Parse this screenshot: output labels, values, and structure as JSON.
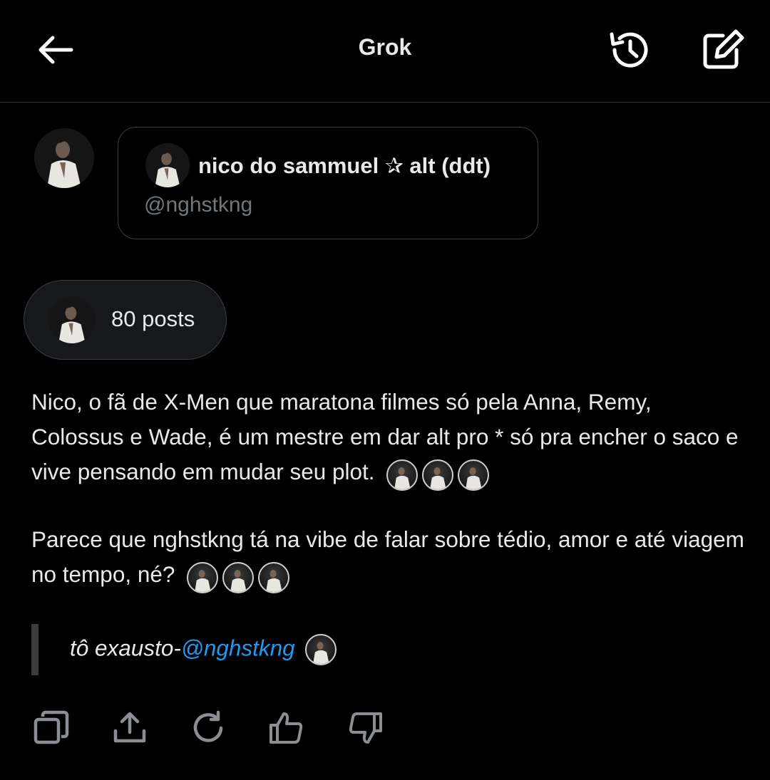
{
  "header": {
    "title": "Grok",
    "back_icon": "arrow-left-icon",
    "history_icon": "history-icon",
    "edit_icon": "compose-icon"
  },
  "profile_card": {
    "name": "nico do sammuel ✰ alt (ddt)",
    "handle": "@nghstkng"
  },
  "posts_pill": {
    "label": "80 posts"
  },
  "body": {
    "paragraph1": "Nico, o fã de X-Men que maratona filmes só pela Anna, Remy, Colossus e Wade, é um mestre em dar alt pro * só pra encher o saco e vive pensando em mudar seu plot.",
    "paragraph2": "Parece que nghstkng tá na vibe de falar sobre tédio, amor e até viagem no tempo, né?",
    "quote_prefix": "tô exausto-",
    "quote_mention": "@nghstkng"
  },
  "actions": {
    "copy": "copy-icon",
    "share": "share-icon",
    "regenerate": "regenerate-icon",
    "like": "thumbs-up-icon",
    "dislike": "thumbs-down-icon"
  },
  "colors": {
    "background": "#000000",
    "text": "#e7e9ea",
    "muted": "#71767b",
    "link": "#1d9bf0",
    "border": "#3a3d40"
  }
}
